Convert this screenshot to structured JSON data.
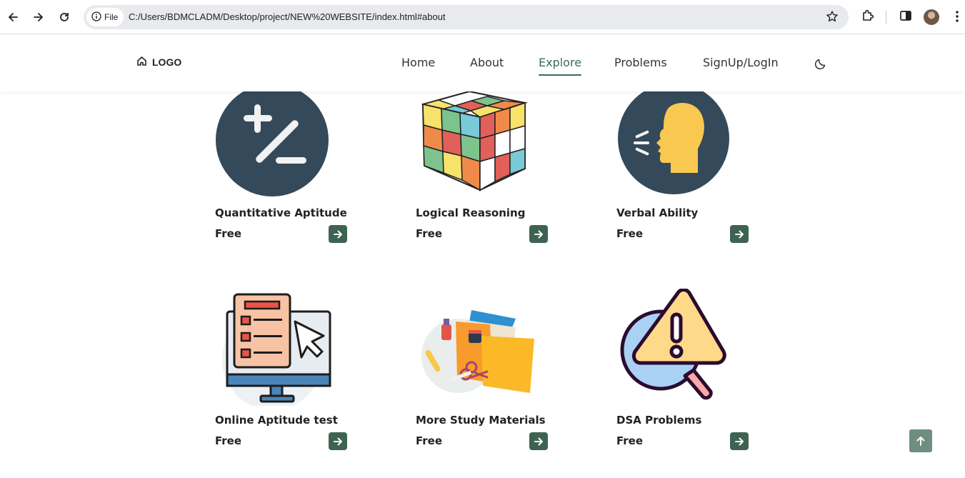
{
  "browser": {
    "file_label": "File",
    "url": "C:/Users/BDMCLADM/Desktop/project/NEW%20WEBSITE/index.html#about",
    "icons": [
      "back-icon",
      "forward-icon",
      "reload-icon",
      "info-icon",
      "star-icon",
      "extensions-icon",
      "side-panel-icon",
      "profile-avatar",
      "menu-icon"
    ]
  },
  "site": {
    "logo": "LOGO",
    "nav": {
      "home": "Home",
      "about": "About",
      "explore": "Explore",
      "problems": "Problems",
      "signup": "SignUp/LogIn"
    },
    "active_nav": "Explore",
    "accent_color": "#3e6352"
  },
  "cards": [
    {
      "title": "Quantitative Aptitude",
      "price": "Free",
      "icon": "plus-minus-icon"
    },
    {
      "title": "Logical Reasoning",
      "price": "Free",
      "icon": "rubiks-cube-icon"
    },
    {
      "title": "Verbal Ability",
      "price": "Free",
      "icon": "speaking-head-icon"
    },
    {
      "title": "Online Aptitude test",
      "price": "Free",
      "icon": "online-test-icon"
    },
    {
      "title": "More Study Materials",
      "price": "Free",
      "icon": "study-materials-icon"
    },
    {
      "title": "DSA Problems",
      "price": "Free",
      "icon": "warning-magnifier-icon"
    }
  ]
}
